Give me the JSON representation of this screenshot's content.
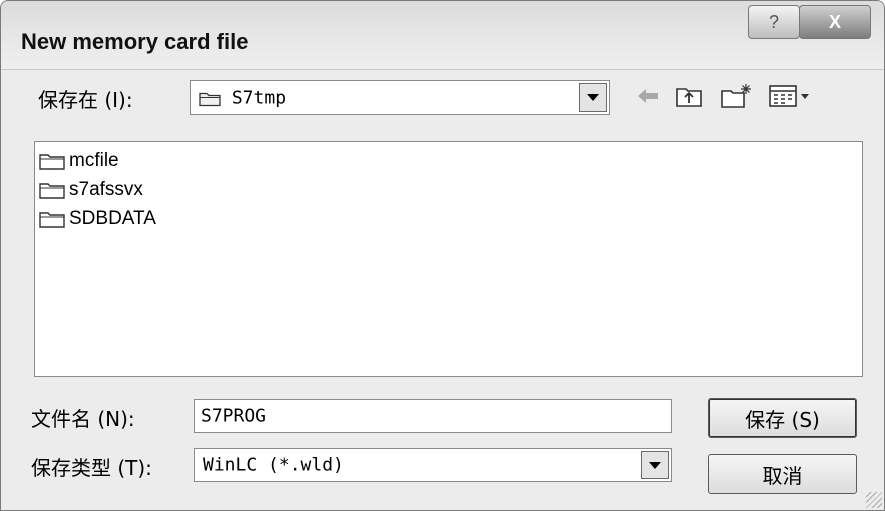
{
  "window": {
    "title": "New memory card file",
    "help_label": "?",
    "close_label": "X"
  },
  "save_in": {
    "label": "保存在 (I):",
    "value": "S7tmp"
  },
  "toolbar": {
    "back_icon": "back-arrow-icon",
    "up_icon": "up-one-level-icon",
    "new_folder_icon": "new-folder-icon",
    "view_icon": "view-menu-icon"
  },
  "files": [
    {
      "name": "mcfile",
      "icon": "folder-icon"
    },
    {
      "name": "s7afssvx",
      "icon": "folder-icon"
    },
    {
      "name": "SDBDATA",
      "icon": "folder-icon"
    }
  ],
  "filename": {
    "label": "文件名 (N):",
    "value": "S7PROG"
  },
  "filetype": {
    "label": "保存类型 (T):",
    "value": "WinLC (*.wld)"
  },
  "buttons": {
    "save": "保存 (S)",
    "cancel": "取消"
  }
}
